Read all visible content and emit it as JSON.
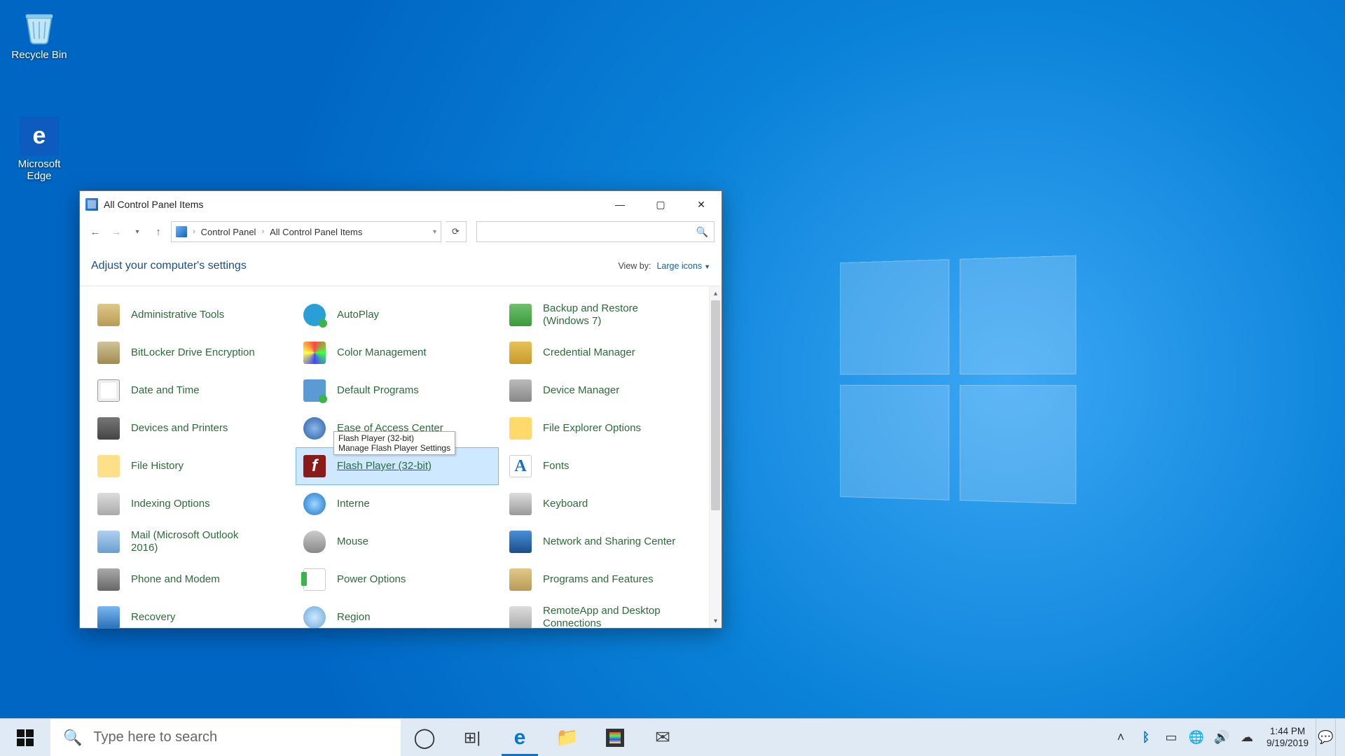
{
  "desktop": {
    "icons": [
      {
        "name": "recycle-bin",
        "label": "Recycle Bin"
      },
      {
        "name": "microsoft-edge",
        "label": "Microsoft Edge"
      }
    ]
  },
  "window": {
    "title": "All Control Panel Items",
    "breadcrumb": {
      "root": "Control Panel",
      "current": "All Control Panel Items"
    },
    "heading": "Adjust your computer's settings",
    "viewby_label": "View by:",
    "viewby_value": "Large icons",
    "items": [
      {
        "label": "Administrative Tools",
        "icon": "pi-admin",
        "name": "administrative-tools"
      },
      {
        "label": "AutoPlay",
        "icon": "pi-autoplay",
        "name": "autoplay"
      },
      {
        "label": "Backup and Restore (Windows 7)",
        "icon": "pi-backup",
        "name": "backup-restore",
        "two": true
      },
      {
        "label": "BitLocker Drive Encryption",
        "icon": "pi-bitlocker",
        "name": "bitlocker"
      },
      {
        "label": "Color Management",
        "icon": "pi-color",
        "name": "color-management"
      },
      {
        "label": "Credential Manager",
        "icon": "pi-cred",
        "name": "credential-manager"
      },
      {
        "label": "Date and Time",
        "icon": "pi-date",
        "name": "date-time"
      },
      {
        "label": "Default Programs",
        "icon": "pi-defprog",
        "name": "default-programs"
      },
      {
        "label": "Device Manager",
        "icon": "pi-devmgr",
        "name": "device-manager"
      },
      {
        "label": "Devices and Printers",
        "icon": "pi-devprint",
        "name": "devices-printers"
      },
      {
        "label": "Ease of Access Center",
        "icon": "pi-ease",
        "name": "ease-of-access"
      },
      {
        "label": "File Explorer Options",
        "icon": "pi-fileopt",
        "name": "file-explorer-options"
      },
      {
        "label": "File History",
        "icon": "pi-filehist",
        "name": "file-history"
      },
      {
        "label": "Flash Player (32-bit)",
        "icon": "pi-flash",
        "name": "flash-player",
        "selected": true
      },
      {
        "label": "Fonts",
        "icon": "pi-fonts",
        "name": "fonts"
      },
      {
        "label": "Indexing Options",
        "icon": "pi-index",
        "name": "indexing-options"
      },
      {
        "label": "Internet Options",
        "icon": "pi-inet",
        "name": "internet-options",
        "truncated": "Interne"
      },
      {
        "label": "Keyboard",
        "icon": "pi-keyboard",
        "name": "keyboard"
      },
      {
        "label": "Mail (Microsoft Outlook 2016)",
        "icon": "pi-mail",
        "name": "mail",
        "two": true
      },
      {
        "label": "Mouse",
        "icon": "pi-mouse",
        "name": "mouse"
      },
      {
        "label": "Network and Sharing Center",
        "icon": "pi-network",
        "name": "network-sharing",
        "two": true
      },
      {
        "label": "Phone and Modem",
        "icon": "pi-phone",
        "name": "phone-modem"
      },
      {
        "label": "Power Options",
        "icon": "pi-power",
        "name": "power-options"
      },
      {
        "label": "Programs and Features",
        "icon": "pi-programs",
        "name": "programs-features"
      },
      {
        "label": "Recovery",
        "icon": "pi-recovery",
        "name": "recovery"
      },
      {
        "label": "Region",
        "icon": "pi-region",
        "name": "region"
      },
      {
        "label": "RemoteApp and Desktop Connections",
        "icon": "pi-remote",
        "name": "remoteapp",
        "two": true
      }
    ],
    "tooltip": {
      "title": "Flash Player (32-bit)",
      "desc": "Manage Flash Player Settings"
    }
  },
  "taskbar": {
    "search_placeholder": "Type here to search",
    "pinned": [
      {
        "name": "cortana",
        "glyph": "◯"
      },
      {
        "name": "task-view",
        "glyph": "⧉"
      },
      {
        "name": "edge",
        "glyph": "e",
        "active": true
      },
      {
        "name": "file-explorer",
        "glyph": "🗂"
      },
      {
        "name": "store",
        "glyph": "🛍"
      },
      {
        "name": "mail",
        "glyph": "✉"
      }
    ],
    "tray": [
      {
        "name": "chevron",
        "glyph": "˄"
      },
      {
        "name": "bluetooth",
        "glyph": "ᛒ"
      },
      {
        "name": "battery",
        "glyph": "▭"
      },
      {
        "name": "network",
        "glyph": "🌐"
      },
      {
        "name": "volume",
        "glyph": "🔊"
      },
      {
        "name": "onedrive",
        "glyph": "☁"
      }
    ],
    "clock": {
      "time": "1:44 PM",
      "date": "9/19/2019"
    }
  }
}
